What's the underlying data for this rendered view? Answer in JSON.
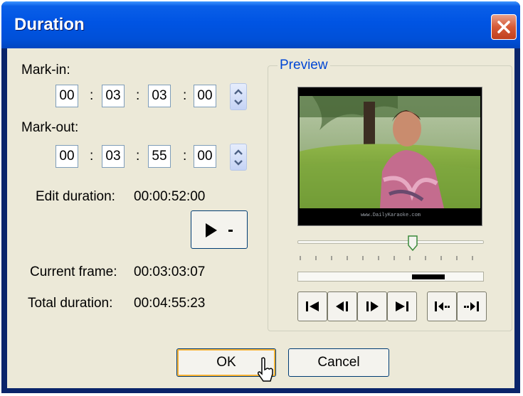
{
  "dialog": {
    "title": "Duration"
  },
  "mark_in": {
    "label": "Mark-in:",
    "hours": "00",
    "minutes": "03",
    "seconds": "03",
    "frames": "00"
  },
  "mark_out": {
    "label": "Mark-out:",
    "hours": "00",
    "minutes": "03",
    "seconds": "55",
    "frames": "00"
  },
  "separator": ":",
  "edit_duration": {
    "label": "Edit duration:",
    "value": "00:00:52:00"
  },
  "current_frame": {
    "label": "Current frame:",
    "value": "00:03:03:07"
  },
  "total_duration": {
    "label": "Total duration:",
    "value": "00:04:55:23"
  },
  "preview": {
    "title": "Preview",
    "watermark": "www.DailyKaraoke.com",
    "position": 0.62
  },
  "buttons": {
    "ok": "OK",
    "cancel": "Cancel"
  },
  "colors": {
    "title_bar": "#0054e3",
    "face": "#ece9d8",
    "group_title": "#0046d5",
    "close": "#d65a36"
  }
}
